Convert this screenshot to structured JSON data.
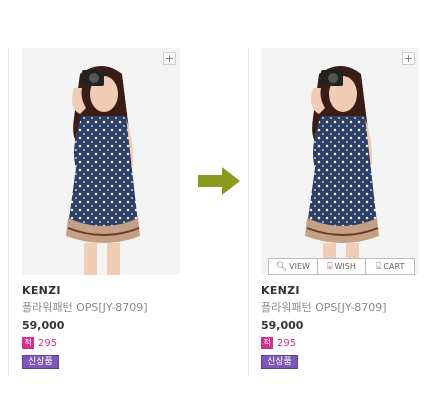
{
  "cards": [
    {
      "brand": "KENZI",
      "name": "플라워패턴 OPS[JY-8709]",
      "price": "59,000",
      "points_icon": "적",
      "points": "295",
      "badge": "신상품"
    },
    {
      "brand": "KENZI",
      "name": "플라워패턴 OPS[JY-8709]",
      "price": "59,000",
      "points_icon": "적",
      "points": "295",
      "badge": "신상품",
      "actions": {
        "view": "VIEW",
        "wish": "WISH",
        "cart": "CART"
      }
    }
  ],
  "colors": {
    "arrow": "#8a9a1e",
    "points": "#d2328a",
    "new_badge": "#7e58b7"
  }
}
